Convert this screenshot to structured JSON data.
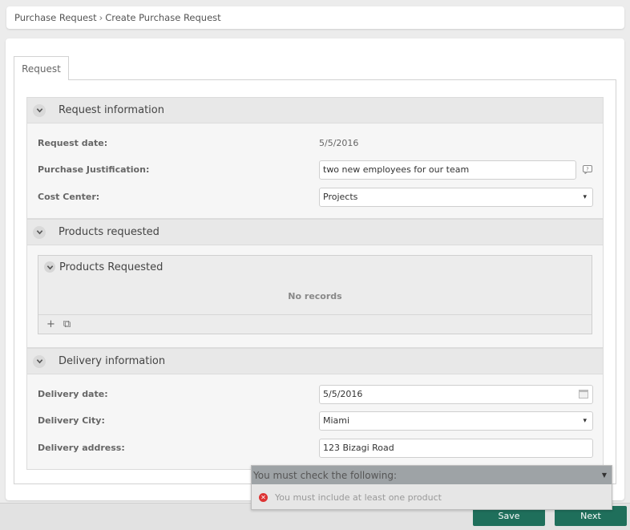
{
  "breadcrumb": {
    "parent": "Purchase Request",
    "separator": "›",
    "current": "Create Purchase Request"
  },
  "tabs": [
    {
      "label": "Request"
    }
  ],
  "sections": {
    "request_info": {
      "title": "Request information",
      "request_date_label": "Request date:",
      "request_date_value": "5/5/2016",
      "justification_label": "Purchase Justification:",
      "justification_value": "two new employees for our team",
      "cost_center_label": "Cost Center:",
      "cost_center_value": "Projects"
    },
    "products": {
      "title": "Products requested",
      "grid_title": "Products Requested",
      "empty_text": "No records",
      "add_glyph": "+",
      "copy_glyph": "⧉"
    },
    "delivery": {
      "title": "Delivery information",
      "date_label": "Delivery date:",
      "date_value": "5/5/2016",
      "city_label": "Delivery City:",
      "city_value": "Miami",
      "address_label": "Delivery address:",
      "address_value": "123 Bizagi Road"
    }
  },
  "validation": {
    "header": "You must check the following:",
    "items": [
      "You must include at least one product"
    ]
  },
  "buttons": {
    "save": "Save",
    "next": "Next"
  },
  "icons": {
    "expand": "chevron-down-icon",
    "help": "help-bubble-icon",
    "calendar": "calendar-icon",
    "error": "error-circle-icon"
  },
  "colors": {
    "primary_button": "#1f6f5b",
    "error": "#dd3333"
  }
}
